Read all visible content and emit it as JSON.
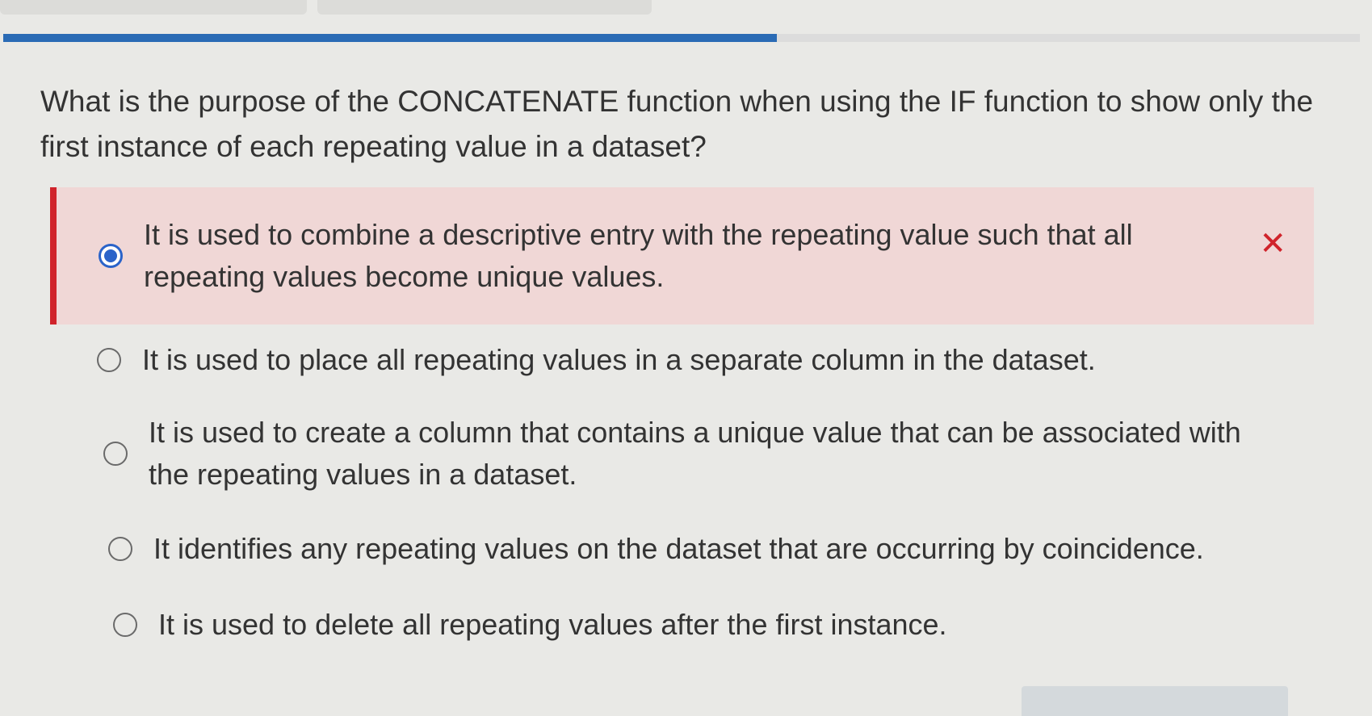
{
  "progress": {
    "fraction": 0.57,
    "fill_color": "#2a6bb5"
  },
  "question": {
    "text": "What is the purpose of the CONCATENATE function when using the IF function to show only the first instance of each repeating value in a dataset?"
  },
  "options": [
    {
      "label": "It is used to combine a descriptive entry with the repeating value such that all repeating values become unique values.",
      "selected": true,
      "status": "incorrect"
    },
    {
      "label": "It is used to place all repeating values in a separate column in the dataset.",
      "selected": false
    },
    {
      "label": "It is used to create a column that contains a unique value that can be associated with the repeating values in a dataset.",
      "selected": false
    },
    {
      "label": "It identifies any repeating values on the dataset that are occurring by coincidence.",
      "selected": false
    },
    {
      "label": "It is used to delete all repeating values after the first instance.",
      "selected": false
    }
  ],
  "feedback": {
    "incorrect_mark": "✕",
    "incorrect_color": "#d0232b",
    "selected_radio_color": "#2a63c9"
  }
}
